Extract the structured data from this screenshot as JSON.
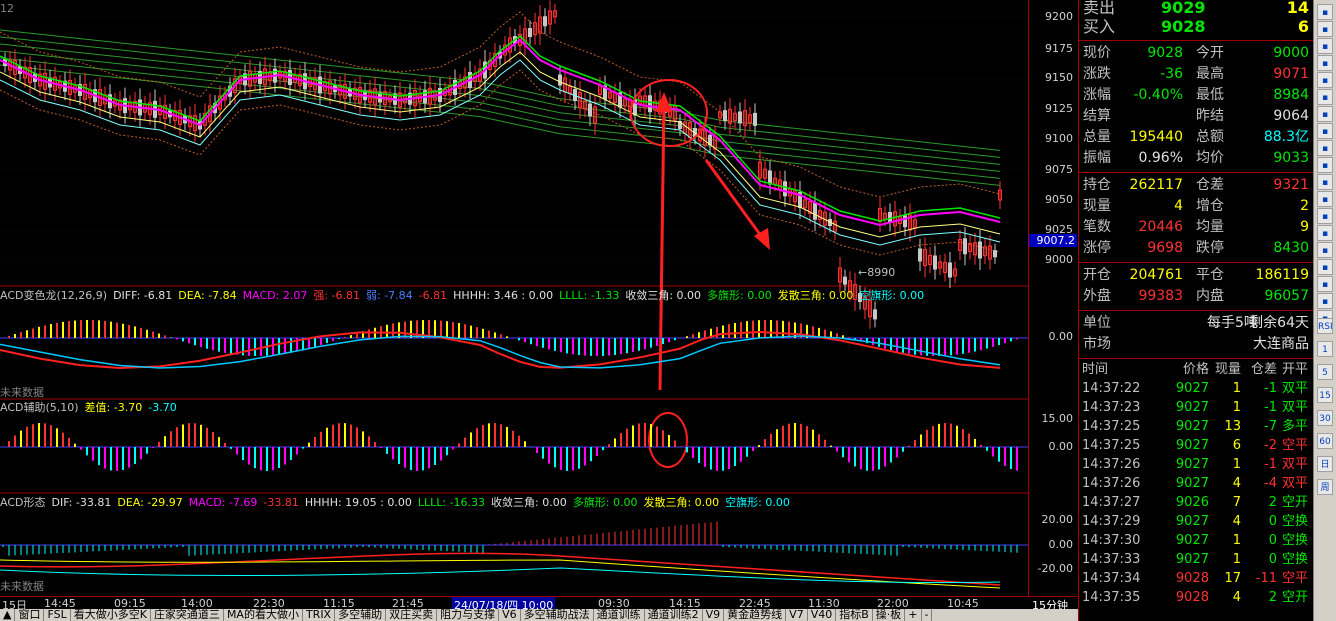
{
  "window_hint": "12",
  "price_chart": {
    "y_ticks": [
      "9200",
      "9175",
      "9150",
      "9125",
      "9100",
      "9075",
      "9050",
      "9025",
      "9000"
    ],
    "last_price_tag": "9007.2",
    "low_marker": "8990"
  },
  "panel_macd": {
    "title_parts": [
      {
        "text": "ACD变色龙(12,26,9)",
        "color": "#c0c0c0"
      },
      {
        "text": "DIFF: -6.81",
        "color": "#e0e0e0"
      },
      {
        "text": "DEA: -7.84",
        "color": "#ffff00"
      },
      {
        "text": "MACD: 2.07",
        "color": "#ff00ff"
      },
      {
        "text": "强: -6.81",
        "color": "#ff3232"
      },
      {
        "text": "弱: -7.84",
        "color": "#4a7dff"
      },
      {
        "text": "-6.81",
        "color": "#ff3232"
      },
      {
        "text": "HHHH: 3.46 : 0.00",
        "color": "#e0e0e0"
      },
      {
        "text": "LLLL: -1.33",
        "color": "#00e600"
      },
      {
        "text": "收敛三角: 0.00",
        "color": "#e0e0e0"
      },
      {
        "text": "多旗形: 0.00",
        "color": "#00e600"
      },
      {
        "text": "发散三角: 0.00",
        "color": "#ffff00"
      },
      {
        "text": "空旗形: 0.00",
        "color": "#00ffff"
      }
    ],
    "y_ticks": [
      "0.00"
    ],
    "watermark": "未来数据"
  },
  "panel_aux": {
    "title_parts": [
      {
        "text": "ACD辅助(5,10)",
        "color": "#c0c0c0"
      },
      {
        "text": "差值: -3.70",
        "color": "#ffff00"
      },
      {
        "text": "-3.70",
        "color": "#00ffff"
      }
    ],
    "y_ticks": [
      "15.00",
      "0.00"
    ]
  },
  "panel_shape": {
    "title_parts": [
      {
        "text": "ACD形态",
        "color": "#c0c0c0"
      },
      {
        "text": "DIF: -33.81",
        "color": "#e0e0e0"
      },
      {
        "text": "DEA: -29.97",
        "color": "#ffff00"
      },
      {
        "text": "MACD: -7.69",
        "color": "#ff00ff"
      },
      {
        "text": "-33.81",
        "color": "#ff3232"
      },
      {
        "text": "HHHH: 19.05 : 0.00",
        "color": "#e0e0e0"
      },
      {
        "text": "LLLL: -16.33",
        "color": "#00e600"
      },
      {
        "text": "收敛三角: 0.00",
        "color": "#e0e0e0"
      },
      {
        "text": "多旗形: 0.00",
        "color": "#00e600"
      },
      {
        "text": "发散三角: 0.00",
        "color": "#ffff00"
      },
      {
        "text": "空旗形: 0.00",
        "color": "#00ffff"
      }
    ],
    "y_ticks": [
      "20.00",
      "0.00",
      "-20.00"
    ],
    "watermark": "未来数据"
  },
  "x_axis": {
    "labels": [
      "15日",
      "14:45",
      "09:15",
      "14:00",
      "22:30",
      "11:15",
      "21:45",
      "10:00",
      "09:30",
      "14:15",
      "22:45",
      "11:30",
      "22:00",
      "10:45"
    ],
    "cursor_label": "24/07/18/四 10:00",
    "period": "15分钟"
  },
  "tabs": [
    "▲",
    "窗口",
    "FSL",
    "看大做小多空K",
    "庄家突通道三",
    "MA的看大做小",
    "TRIX",
    "多空辅助",
    "双庄买卖",
    "阻力与支撑",
    "V6",
    "多空辅助战法",
    "通道训练",
    "通道训练2",
    "V9",
    "黄金趋势线",
    "V7",
    "V40",
    "指标B",
    "操·板",
    "+",
    "-"
  ],
  "quote": {
    "sell": {
      "label": "卖出",
      "price": "9029",
      "volume": "14"
    },
    "buy": {
      "label": "买入",
      "price": "9028",
      "volume": "6"
    },
    "rows1": [
      {
        "l": "现价",
        "v": "9028",
        "vc": "#00e600",
        "l2": "今开",
        "v2": "9000",
        "v2c": "#00e600"
      },
      {
        "l": "涨跌",
        "v": "-36",
        "vc": "#00e600",
        "l2": "最高",
        "v2": "9071",
        "v2c": "#ff3232"
      },
      {
        "l": "涨幅",
        "v": "-0.40%",
        "vc": "#00e600",
        "l2": "最低",
        "v2": "8984",
        "v2c": "#00e600"
      },
      {
        "l": "结算",
        "v": "",
        "vc": "#e0e0e0",
        "l2": "昨结",
        "v2": "9064",
        "v2c": "#e0e0e0"
      },
      {
        "l": "总量",
        "v": "195440",
        "vc": "#ffff00",
        "l2": "总额",
        "v2": "88.3亿",
        "v2c": "#00ffff"
      },
      {
        "l": "振幅",
        "v": "0.96%",
        "vc": "#e0e0e0",
        "l2": "均价",
        "v2": "9033",
        "v2c": "#00e600"
      }
    ],
    "rows2": [
      {
        "l": "持仓",
        "v": "262117",
        "vc": "#ffff00",
        "l2": "仓差",
        "v2": "9321",
        "v2c": "#ff3232"
      },
      {
        "l": "现量",
        "v": "4",
        "vc": "#ffff00",
        "l2": "增仓",
        "v2": "2",
        "v2c": "#ffff00"
      },
      {
        "l": "笔数",
        "v": "20446",
        "vc": "#ff3232",
        "l2": "均量",
        "v2": "9",
        "v2c": "#ffff00"
      },
      {
        "l": "涨停",
        "v": "9698",
        "vc": "#ff3232",
        "l2": "跌停",
        "v2": "8430",
        "v2c": "#00e600"
      }
    ],
    "rows3": [
      {
        "l": "开仓",
        "v": "204761",
        "vc": "#ffff00",
        "l2": "平仓",
        "v2": "186119",
        "v2c": "#ffff00"
      },
      {
        "l": "外盘",
        "v": "99383",
        "vc": "#ff3232",
        "l2": "内盘",
        "v2": "96057",
        "v2c": "#00e600"
      }
    ],
    "unit": {
      "label": "单位",
      "value": "每手5吨",
      "remain": "剩余64天"
    },
    "market": {
      "label": "市场",
      "value": "大连商品"
    },
    "ticks_header": [
      "时间",
      "价格",
      "现量",
      "仓差",
      "开平"
    ],
    "ticks": [
      {
        "t": "14:37:22",
        "p": "9027",
        "pc": "#00e600",
        "q": "1",
        "d": "-1",
        "dc": "#00e600",
        "k": "双平",
        "kc": "#00e600"
      },
      {
        "t": "14:37:23",
        "p": "9027",
        "pc": "#00e600",
        "q": "1",
        "d": "-1",
        "dc": "#00e600",
        "k": "双平",
        "kc": "#00e600"
      },
      {
        "t": "14:37:25",
        "p": "9027",
        "pc": "#00e600",
        "q": "13",
        "d": "-7",
        "dc": "#00e600",
        "k": "多平",
        "kc": "#00e600"
      },
      {
        "t": "14:37:25",
        "p": "9027",
        "pc": "#00e600",
        "q": "6",
        "d": "-2",
        "dc": "#ff3232",
        "k": "空平",
        "kc": "#ff3232"
      },
      {
        "t": "14:37:26",
        "p": "9027",
        "pc": "#00e600",
        "q": "1",
        "d": "-1",
        "dc": "#ff3232",
        "k": "双平",
        "kc": "#ff3232"
      },
      {
        "t": "14:37:26",
        "p": "9027",
        "pc": "#00e600",
        "q": "4",
        "d": "-4",
        "dc": "#ff3232",
        "k": "双平",
        "kc": "#ff3232"
      },
      {
        "t": "14:37:27",
        "p": "9026",
        "pc": "#00e600",
        "q": "7",
        "d": "2",
        "dc": "#00e600",
        "k": "空开",
        "kc": "#00e600"
      },
      {
        "t": "14:37:29",
        "p": "9027",
        "pc": "#00e600",
        "q": "4",
        "d": "0",
        "dc": "#00e600",
        "k": "空换",
        "kc": "#00e600"
      },
      {
        "t": "14:37:30",
        "p": "9027",
        "pc": "#00e600",
        "q": "1",
        "d": "0",
        "dc": "#00e600",
        "k": "空换",
        "kc": "#00e600"
      },
      {
        "t": "14:37:33",
        "p": "9027",
        "pc": "#00e600",
        "q": "1",
        "d": "0",
        "dc": "#00e600",
        "k": "空换",
        "kc": "#00e600"
      },
      {
        "t": "14:37:34",
        "p": "9028",
        "pc": "#ff3232",
        "q": "17",
        "d": "-11",
        "dc": "#ff3232",
        "k": "空平",
        "kc": "#ff3232"
      },
      {
        "t": "14:37:35",
        "p": "9028",
        "pc": "#ff3232",
        "q": "4",
        "d": "2",
        "dc": "#00e600",
        "k": "空开",
        "kc": "#00e600"
      }
    ]
  },
  "toolbar": [
    "RSI",
    "1",
    "5",
    "15",
    "30",
    "60",
    "日",
    "周"
  ]
}
